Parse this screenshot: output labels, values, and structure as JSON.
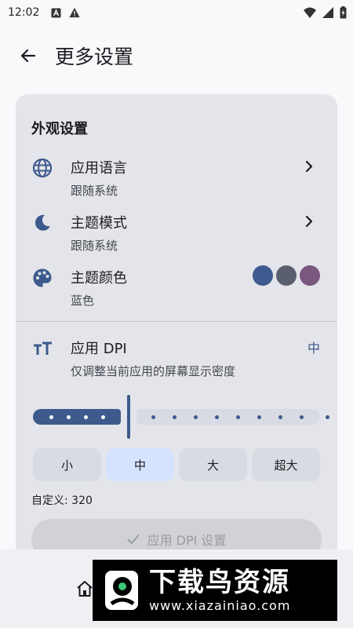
{
  "status_bar": {
    "time": "12:02",
    "icons_left": [
      "a-notification-icon",
      "warning-icon"
    ],
    "icons_right": [
      "wifi-icon",
      "signal-icon",
      "battery-icon"
    ]
  },
  "app_bar": {
    "title": "更多设置"
  },
  "appearance": {
    "section_title": "外观设置",
    "language": {
      "title": "应用语言",
      "subtitle": "跟随系统"
    },
    "theme_mode": {
      "title": "主题模式",
      "subtitle": "跟随系统"
    },
    "theme_color": {
      "title": "主题颜色",
      "subtitle": "蓝色",
      "swatches": [
        "#3e5a8e",
        "#5a5f6e",
        "#7a587e"
      ]
    }
  },
  "dpi": {
    "title": "应用 DPI",
    "subtitle": "仅调整当前应用的屏幕显示密度",
    "current": "中",
    "slider_level": 0.33,
    "options": [
      "小",
      "中",
      "大",
      "超大"
    ],
    "selected_option": "中",
    "custom_label": "自定义: 320",
    "apply_button": "应用 DPI 设置"
  },
  "colors": {
    "accent": "#3d5a8d",
    "card": "#e4e5ea",
    "selected_segment": "#d6e3ff"
  },
  "watermark": {
    "main": "下载鸟资源",
    "url": "www.xiazainiao.com"
  }
}
